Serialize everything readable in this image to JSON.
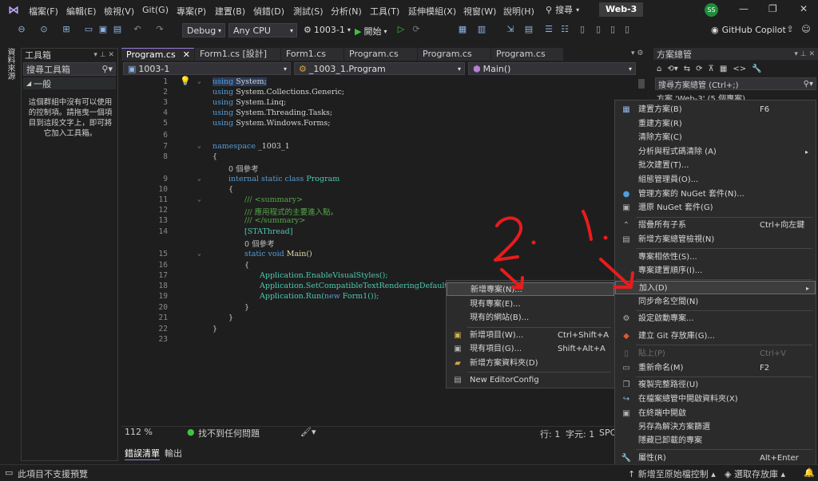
{
  "menubar": {
    "items": [
      "檔案(F)",
      "編輯(E)",
      "檢視(V)",
      "Git(G)",
      "專案(P)",
      "建置(B)",
      "偵錯(D)",
      "測試(S)",
      "分析(N)",
      "工具(T)",
      "延伸模組(X)",
      "視窗(W)",
      "說明(H)"
    ],
    "search_label": "搜尋",
    "solution_name": "Web-3",
    "avatar_initials": "SS"
  },
  "toolbar": {
    "config": "Debug",
    "platform": "Any CPU",
    "startup_project": "1003-1",
    "start_label": "開始",
    "copilot": "GitHub Copilot"
  },
  "left_strip": {
    "label": "資料來源"
  },
  "toolbox": {
    "title": "工具箱",
    "search_placeholder": "搜尋工具箱",
    "group": "一般",
    "empty_text": "這個群組中沒有可以使用的控制項。請拖曳一個項目到這段文字上，即可將它加入工具箱。"
  },
  "editor": {
    "tabs": [
      "Program.cs",
      "Form1.cs [設計]",
      "Form1.cs",
      "Program.cs",
      "Program.cs",
      "Program.cs"
    ],
    "nav_project": "1003-1",
    "nav_class": "_1003_1.Program",
    "nav_member": "Main()",
    "line_numbers": [
      "1",
      "2",
      "3",
      "4",
      "5",
      "6",
      "7",
      "8",
      "",
      "9",
      "10",
      "11",
      "12",
      "13",
      "14",
      "",
      "15",
      "16",
      "17",
      "18",
      "19",
      "20",
      "21",
      "22",
      "23"
    ],
    "zoom": "112 %",
    "issues": "找不到任何問題",
    "position_line": "行: 1",
    "position_col": "字元: 1",
    "encoding": "SPC"
  },
  "code": {
    "l1_kw": "using",
    "l1_rest": " System;",
    "l2_kw": "using",
    "l2_rest": " System.Collections.Generic;",
    "l3_kw": "using",
    "l3_rest": " System.Linq;",
    "l4_kw": "using",
    "l4_rest": " System.Threading.Tasks;",
    "l5_kw": "using",
    "l5_rest": " System.Windows.Forms;",
    "l7_kw": "namespace",
    "l7_rest": " _1003_1",
    "l8": "{",
    "ref1": "0 個參考",
    "l9_kw": "internal static class",
    "l9_ty": " Program",
    "l10": "{",
    "l11": "/// <summary>",
    "l12": "/// 應用程式的主要進入點。",
    "l13": "/// </summary>",
    "l14": "[STAThread]",
    "ref2": "0 個參考",
    "l15_kw": "static void",
    "l15_rest": " Main()",
    "l16": "{",
    "l17": "Application.EnableVisualStyles();",
    "l18": "Application.SetCompatibleTextRenderingDefault(fa",
    "l19_a": "Application.Run(",
    "l19_kw": "new",
    "l19_b": " Form1());",
    "l20": "}",
    "l21": "}",
    "l22": "}"
  },
  "output_tabs": [
    "錯誤清單",
    "輸出"
  ],
  "solution_explorer": {
    "title": "方案總管",
    "search_placeholder": "搜尋方案總管 (Ctrl+;)",
    "root_item": "方案 'Web-3' (5 個專案)"
  },
  "context_menu": {
    "items": [
      {
        "label": "建置方案(B)",
        "shortcut": "F6",
        "icon": "build-icon"
      },
      {
        "label": "重建方案(R)",
        "shortcut": "",
        "icon": ""
      },
      {
        "label": "清除方案(C)",
        "shortcut": "",
        "icon": ""
      },
      {
        "label": "分析與程式碼清除 (A)",
        "shortcut": "",
        "icon": "",
        "submenu": true
      },
      {
        "label": "批次建置(T)...",
        "shortcut": "",
        "icon": ""
      },
      {
        "label": "組態管理員(O)...",
        "shortcut": "",
        "icon": ""
      },
      {
        "label": "管理方案的 NuGet 套件(N)...",
        "shortcut": "",
        "icon": "nuget-icon"
      },
      {
        "label": "還原 NuGet 套件(G)",
        "shortcut": "",
        "icon": "restore-icon"
      },
      {
        "label": "摺疊所有子系",
        "shortcut": "Ctrl+向左鍵",
        "icon": "collapse-icon"
      },
      {
        "label": "新增方案總管檢視(N)",
        "shortcut": "",
        "icon": "new-view-icon"
      },
      {
        "label": "專案相依性(S)...",
        "shortcut": "",
        "icon": ""
      },
      {
        "label": "專案建置順序(I)...",
        "shortcut": "",
        "icon": ""
      },
      {
        "label": "加入(D)",
        "shortcut": "",
        "icon": "",
        "submenu": true
      },
      {
        "label": "同步命名空間(N)",
        "shortcut": "",
        "icon": ""
      },
      {
        "label": "設定啟動專案...",
        "shortcut": "",
        "icon": "gear-icon"
      },
      {
        "label": "建立 Git 存放庫(G)...",
        "shortcut": "",
        "icon": "git-icon"
      },
      {
        "label": "貼上(P)",
        "shortcut": "Ctrl+V",
        "icon": "paste-icon",
        "disabled": true
      },
      {
        "label": "重新命名(M)",
        "shortcut": "F2",
        "icon": "rename-icon"
      },
      {
        "label": "複製完整路徑(U)",
        "shortcut": "",
        "icon": "copy-icon"
      },
      {
        "label": "在檔案總管中開啟資料夾(X)",
        "shortcut": "",
        "icon": "open-folder-icon"
      },
      {
        "label": "在終端中開啟",
        "shortcut": "",
        "icon": "terminal-icon"
      },
      {
        "label": "另存為解決方案篩選",
        "shortcut": "",
        "icon": ""
      },
      {
        "label": "隱藏已卸載的專案",
        "shortcut": "",
        "icon": ""
      },
      {
        "label": "屬性(R)",
        "shortcut": "Alt+Enter",
        "icon": "wrench-icon"
      }
    ]
  },
  "submenu": {
    "items": [
      {
        "label": "新增專案(N)...",
        "shortcut": "",
        "icon": ""
      },
      {
        "label": "現有專案(E)...",
        "shortcut": "",
        "icon": ""
      },
      {
        "label": "現有的網站(B)...",
        "shortcut": "",
        "icon": ""
      },
      {
        "label": "新增項目(W)...",
        "shortcut": "Ctrl+Shift+A",
        "icon": "new-item-icon"
      },
      {
        "label": "現有項目(G)...",
        "shortcut": "Shift+Alt+A",
        "icon": "existing-item-icon"
      },
      {
        "label": "新增方案資料夾(D)",
        "shortcut": "",
        "icon": "folder-icon"
      },
      {
        "label": "New EditorConfig",
        "shortcut": "",
        "icon": "editorconfig-icon"
      }
    ]
  },
  "annotations": {
    "one": "1.",
    "two": "2."
  },
  "statusbar": {
    "left": "此項目不支援預覽",
    "source_control": "新增至原始檔控制",
    "repo": "選取存放庫"
  },
  "colors": {
    "accent": "#9b7ad8",
    "annotation": "#e81c1c",
    "keyword": "#569cd6",
    "type": "#4ec9b0",
    "comment": "#57a64a"
  }
}
